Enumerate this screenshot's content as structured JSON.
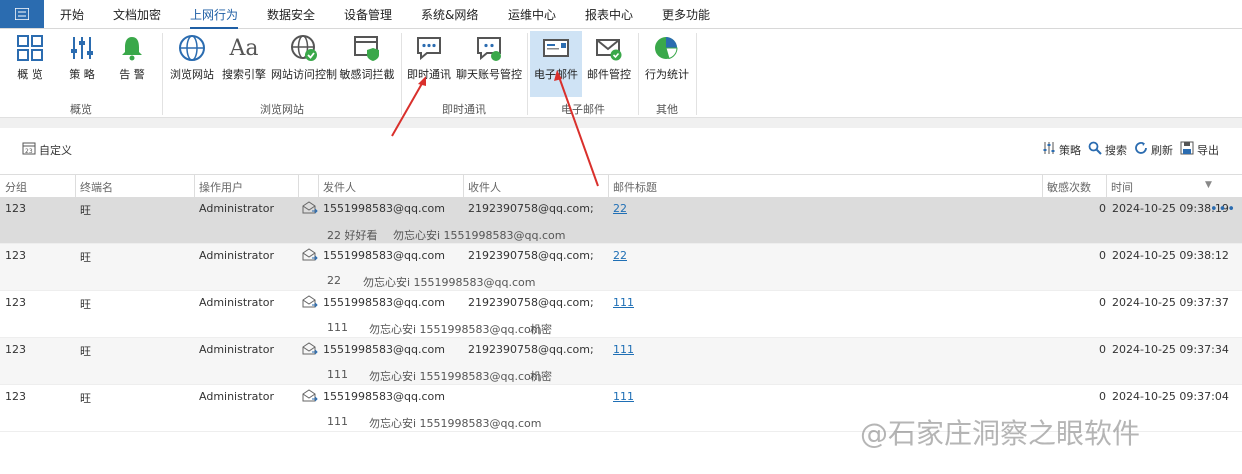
{
  "menubar": {
    "app_icon": "list-icon",
    "items": [
      "开始",
      "文档加密",
      "上网行为",
      "数据安全",
      "设备管理",
      "系统&网络",
      "运维中心",
      "报表中心",
      "更多功能"
    ],
    "active_index": 2
  },
  "ribbon": {
    "buttons": [
      {
        "label": "概 览",
        "icon": "grid-icon"
      },
      {
        "label": "策 略",
        "icon": "sliders-icon"
      },
      {
        "label": "告 警",
        "icon": "bell-icon"
      },
      {
        "label": "浏览网站",
        "icon": "globe-icon"
      },
      {
        "label": "搜索引擎",
        "icon": "font-aa-icon"
      },
      {
        "label": "网站访问控制",
        "icon": "globe-check-icon"
      },
      {
        "label": "敏感词拦截",
        "icon": "browser-shield-icon"
      },
      {
        "label": "即时通讯",
        "icon": "chat-bubble-icon"
      },
      {
        "label": "聊天账号管控",
        "icon": "chat-account-icon"
      },
      {
        "label": "电子邮件",
        "icon": "email-icon"
      },
      {
        "label": "邮件管控",
        "icon": "mail-check-icon"
      },
      {
        "label": "行为统计",
        "icon": "pie-chart-icon"
      }
    ],
    "groups": [
      "概览",
      "浏览网站",
      "即时通讯",
      "电子邮件",
      "其他"
    ],
    "selected_button": "电子邮件"
  },
  "toolbar": {
    "custom_label": "自定义",
    "policy_label": "策略",
    "search_label": "搜索",
    "refresh_label": "刷新",
    "export_label": "导出"
  },
  "table": {
    "columns": [
      "分组",
      "终端名",
      "操作用户",
      "发件人",
      "收件人",
      "邮件标题",
      "敏感次数",
      "时间"
    ],
    "rows": [
      {
        "group": "123",
        "terminal": "旺",
        "user": "Administrator",
        "sender": "1551998583@qq.com",
        "recipient": "2192390758@qq.com;",
        "subject": "22",
        "count": "0",
        "time": "2024-10-25 09:38:19",
        "preview_a": "22 好好看",
        "preview_b": "勿忘心安i 1551998583@qq.com",
        "preview_c": ""
      },
      {
        "group": "123",
        "terminal": "旺",
        "user": "Administrator",
        "sender": "1551998583@qq.com",
        "recipient": "2192390758@qq.com;",
        "subject": "22",
        "count": "0",
        "time": "2024-10-25 09:38:12",
        "preview_a": "22",
        "preview_b": "勿忘心安i 1551998583@qq.com",
        "preview_c": ""
      },
      {
        "group": "123",
        "terminal": "旺",
        "user": "Administrator",
        "sender": "1551998583@qq.com",
        "recipient": "2192390758@qq.com;",
        "subject": "111",
        "count": "0",
        "time": "2024-10-25 09:37:37",
        "preview_a": "111",
        "preview_b": "勿忘心安i 1551998583@qq.com",
        "preview_c": "机密"
      },
      {
        "group": "123",
        "terminal": "旺",
        "user": "Administrator",
        "sender": "1551998583@qq.com",
        "recipient": "2192390758@qq.com;",
        "subject": "111",
        "count": "0",
        "time": "2024-10-25 09:37:34",
        "preview_a": "111",
        "preview_b": "勿忘心安i 1551998583@qq.com",
        "preview_c": "机密"
      },
      {
        "group": "123",
        "terminal": "旺",
        "user": "Administrator",
        "sender": "1551998583@qq.com",
        "recipient": "",
        "subject": "111",
        "count": "0",
        "time": "2024-10-25 09:37:04",
        "preview_a": "111",
        "preview_b": "勿忘心安i 1551998583@qq.com",
        "preview_c": ""
      }
    ]
  },
  "watermark": "@石家庄洞察之眼软件",
  "colors": {
    "accent": "#1f5fa5",
    "selected_row": "#dcdcdc",
    "arrow": "#d9302c"
  }
}
